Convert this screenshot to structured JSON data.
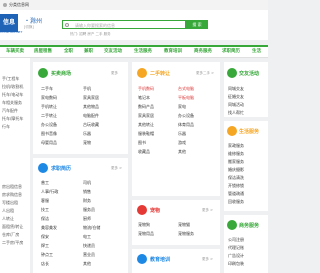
{
  "browser": {
    "tab_title": "分类信息网"
  },
  "header": {
    "logo_text": "信息",
    "logo_sub": "CHUZHOU.NET",
    "city": "・滁州",
    "city_switch": "[切换]",
    "search_placeholder": "请输入你要搜索的信息",
    "search_button": "搜 索",
    "hot_text": "热门: 招聘 房产 二手 服务"
  },
  "nav": {
    "items": [
      "车辆买卖",
      "房屋租售",
      "全职",
      "兼职",
      "交友活动",
      "生活服务",
      "教育培训",
      "商务服务",
      "求职简历",
      "生活"
    ]
  },
  "left_column": {
    "items": [
      "手/工程车",
      "拉机/收割机",
      "托车/电动车",
      "车相关服务",
      "汽车配件",
      "托车/摩托车",
      "行车",
      "",
      "",
      "",
      "",
      "房出租信息",
      "房求购信息",
      "写楼出租",
      "人出租",
      "人转让",
      "面租赁/转让",
      "仓库/厂房",
      "二手房/平房"
    ]
  },
  "cards": {
    "buy_sell": {
      "title": "买卖商场",
      "more": "更多",
      "links": [
        "二手车",
        "手机",
        "家电数码",
        "家具家居",
        "手机转让",
        "其他物品",
        "二手转让",
        "电脑配件",
        "办公设备",
        "古玩收藏",
        "图书音像",
        "乐器",
        "母婴用品",
        "宠物"
      ]
    },
    "second_hand": {
      "title": "二手转让",
      "more": "更多二手 >",
      "links": [
        "手机数码",
        "台式电脑",
        "笔记本",
        "平板电脑",
        "数码产品",
        "家电",
        "家具家居",
        "办公设备",
        "其他转让",
        "体育用品",
        "服装鞋帽",
        "乐器",
        "图书",
        "游戏",
        "收藏品",
        "其他"
      ]
    },
    "social": {
      "title": "交友活动",
      "more": "更多 >",
      "links": [
        "同城交友",
        "征婚交友",
        "同城活动",
        "找人帮忙"
      ]
    },
    "life": {
      "title": "生活服务",
      "more": "更多 >",
      "links": [
        "家政服务",
        "维修服务",
        "搬家服务",
        "婚庆摄影",
        "保洁清洗",
        "开锁修锁",
        "管道疏通",
        "回收服务"
      ]
    },
    "jobs": {
      "title": "求职简历",
      "more": "更多 >",
      "links": [
        "普工",
        "司机",
        "人事/行政",
        "销售",
        "客服",
        "财务",
        "技工",
        "服务员",
        "保洁",
        "厨师",
        "美容美发",
        "物流/仓储",
        "保安",
        "电工",
        "焊工",
        "快递员",
        "钟点工",
        "营业员",
        "店长",
        "其他"
      ]
    },
    "pets": {
      "title": "宠物",
      "more": "更多 >",
      "links": [
        "宠物狗",
        "宠物猫",
        "宠物用品",
        "宠物服务"
      ]
    },
    "edu": {
      "title": "教育培训",
      "more": "更多 >",
      "links": []
    },
    "business": {
      "title": "商务服务",
      "more": "更多 >",
      "links": [
        "公司注册",
        "代理记账",
        "广告设计",
        "印刷包装"
      ]
    }
  },
  "colors": {
    "accent": "#38a83a",
    "brand": "#1e63b6",
    "red": "#d33333"
  }
}
